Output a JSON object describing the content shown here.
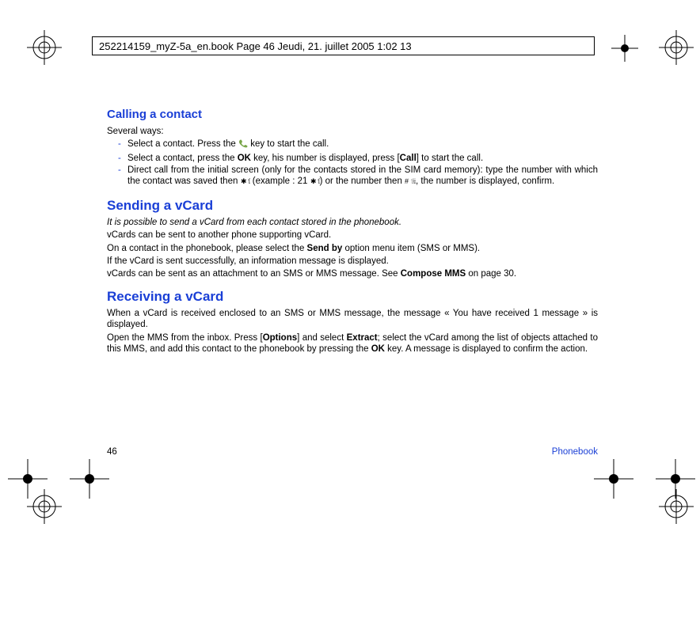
{
  "header": {
    "meta_line": "252214159_myZ-5a_en.book  Page 46  Jeudi, 21. juillet 2005  1:02 13"
  },
  "sections": {
    "calling": {
      "title": "Calling a contact",
      "intro": "Several ways:",
      "items": {
        "a_pre": "Select a contact. Press the ",
        "a_post": " key to start the call.",
        "b_pre": "Select a contact, press the ",
        "b_key": "OK",
        "b_mid": " key, his number is displayed, press [",
        "b_call": "Call",
        "b_post": "] to start the call.",
        "c_line1_pre": "Direct call from the initial screen (only for the contacts stored in the SIM card memory): type the number with which the contact was saved then ",
        "c_line1_mid": " (example : 21 ",
        "c_line1_mid2": ") or the number then ",
        "c_line1_post": ", the number is displayed, confirm."
      }
    },
    "sending": {
      "title": "Sending a vCard",
      "p1": "It is possible to send a vCard from each contact stored in the phonebook.",
      "p2": "vCards can be sent to another phone supporting vCard.",
      "p3_pre": "On a contact in the phonebook, please select the ",
      "p3_bold": "Send by",
      "p3_post": " option menu item (SMS or MMS).",
      "p4": "If the vCard is sent successfully, an information message is displayed.",
      "p5_pre": "vCards can be sent as an attachment to an SMS or MMS message. See ",
      "p5_bold": "Compose MMS",
      "p5_post": " on page 30."
    },
    "receiving": {
      "title": "Receiving a vCard",
      "p1": "When a vCard is received enclosed to an SMS or MMS message, the message « You have received 1 message » is displayed.",
      "p2_pre": "Open the MMS from the inbox. Press [",
      "p2_opt": "Options",
      "p2_mid": "] and select ",
      "p2_ext": "Extract",
      "p2_mid2": "; select the vCard among the list of objects attached to this MMS, and add this contact to the phonebook by pressing the ",
      "p2_ok": "OK",
      "p2_post": " key. A message is displayed to confirm the action."
    }
  },
  "footer": {
    "page_number": "46",
    "section_name": "Phonebook"
  }
}
